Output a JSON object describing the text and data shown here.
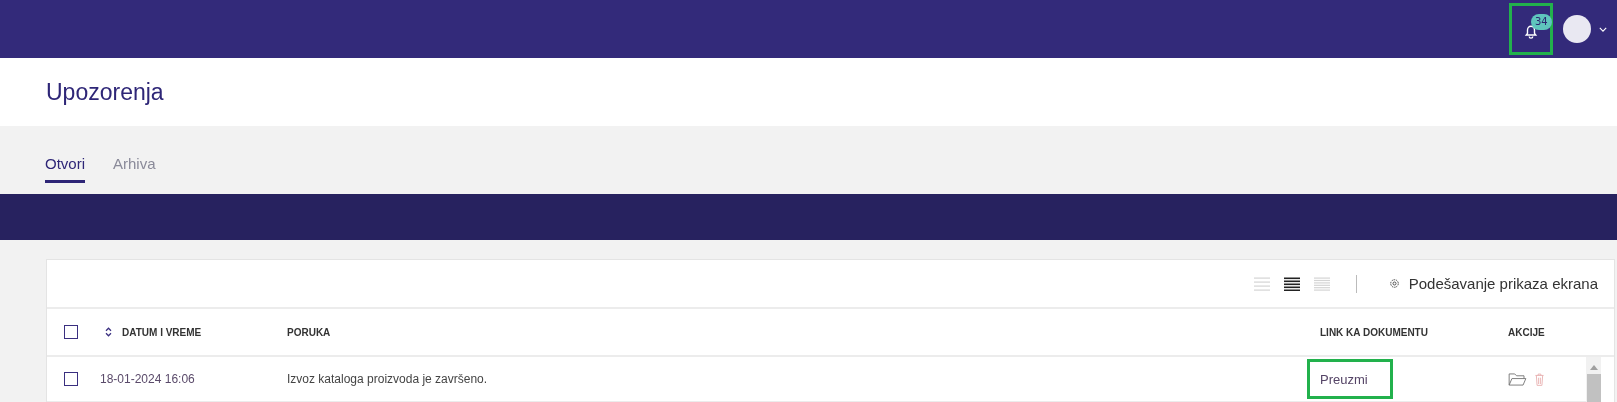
{
  "top_bar": {
    "notifications": {
      "count": "34",
      "highlighted": true
    }
  },
  "page_title": "Upozorenja",
  "tabs": [
    {
      "label": "Otvori",
      "selected": true
    },
    {
      "label": "Arhiva",
      "selected": false
    }
  ],
  "toolbar": {
    "density_options": [
      {
        "kind": "wide",
        "selected": false
      },
      {
        "kind": "normal",
        "selected": true
      },
      {
        "kind": "dense",
        "selected": false
      }
    ],
    "settings_label": "Podešavanje prikaza ekrana"
  },
  "table": {
    "select_all": {
      "checked": false
    },
    "columns": [
      {
        "label": "DATUM I VREME",
        "sortable": true
      },
      {
        "label": "PORUKA",
        "sortable": false
      },
      {
        "label": "LINK KA DOKUMENTU",
        "sortable": false
      },
      {
        "label": "AKCIJE",
        "sortable": false
      }
    ],
    "rows": [
      {
        "checked": false,
        "date": "18-01-2024 16:06",
        "message": "Izvoz kataloga proizvoda je završeno.",
        "link": "Preuzmi",
        "link_highlighted": true
      }
    ]
  }
}
